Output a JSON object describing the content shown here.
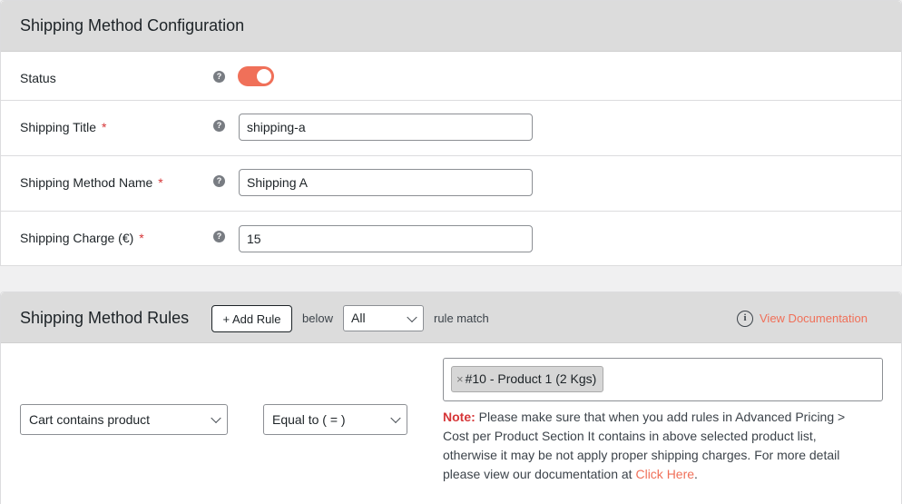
{
  "config": {
    "title": "Shipping Method Configuration",
    "help_glyph": "?",
    "required_mark": "*",
    "status": {
      "label": "Status",
      "enabled": true
    },
    "shipping_title": {
      "label": "Shipping Title",
      "value": "shipping-a"
    },
    "method_name": {
      "label": "Shipping Method Name",
      "value": "Shipping A"
    },
    "charge": {
      "label": "Shipping Charge (€)",
      "value": "15"
    }
  },
  "rules": {
    "title": "Shipping Method Rules",
    "add_rule_label": "+ Add Rule",
    "below_text": "below",
    "match_select": "All",
    "rule_match_text": "rule match",
    "documentation": {
      "icon_glyph": "i",
      "label": "View Documentation"
    },
    "rule": {
      "condition": "Cart contains product",
      "operator": "Equal to ( = )",
      "selected_product": {
        "remove_glyph": "×",
        "label": "#10 - Product 1 (2 Kgs)"
      }
    },
    "note": {
      "label": "Note:",
      "text": " Please make sure that when you add rules in Advanced Pricing > Cost per Product Section It contains in above selected product list, otherwise it may be not apply proper shipping charges. For more detail please view our documentation at ",
      "link_text": "Click Here",
      "end": "."
    }
  },
  "colors": {
    "accent": "#f07059",
    "required": "#d63638",
    "header_bg": "#dcdcdc"
  }
}
